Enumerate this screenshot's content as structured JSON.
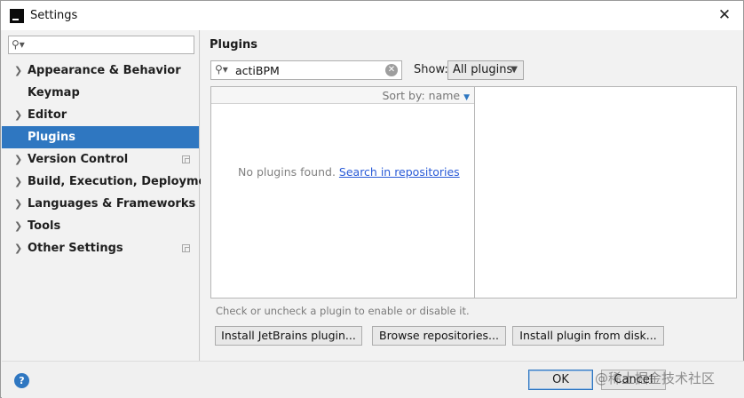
{
  "window": {
    "title": "Settings",
    "close_glyph": "✕"
  },
  "sidebar": {
    "search_icon": "search-icon",
    "items": [
      {
        "label": "Appearance & Behavior",
        "expandable": true
      },
      {
        "label": "Keymap",
        "expandable": false
      },
      {
        "label": "Editor",
        "expandable": true
      },
      {
        "label": "Plugins",
        "expandable": false,
        "selected": true
      },
      {
        "label": "Version Control",
        "expandable": true,
        "copy_icon": true
      },
      {
        "label": "Build, Execution, Deployment",
        "expandable": true
      },
      {
        "label": "Languages & Frameworks",
        "expandable": true
      },
      {
        "label": "Tools",
        "expandable": true
      },
      {
        "label": "Other Settings",
        "expandable": true,
        "copy_icon": true
      }
    ]
  },
  "plugins": {
    "title": "Plugins",
    "search_value": "actiBPM",
    "show_label": "Show:",
    "show_selected": "All plugins",
    "sort_label": "Sort by: name",
    "empty_text": "No plugins found.",
    "empty_link": "Search in repositories",
    "hint": "Check or uncheck a plugin to enable or disable it.",
    "buttons": {
      "install_jetbrains": "Install JetBrains plugin...",
      "browse": "Browse repositories...",
      "install_disk": "Install plugin from disk..."
    }
  },
  "footer": {
    "help": "?",
    "ok": "OK",
    "cancel": "Cancel",
    "watermark": "@稀土掘金技术社区"
  },
  "colors": {
    "selection": "#2f77c1",
    "link": "#2a5bd7"
  }
}
